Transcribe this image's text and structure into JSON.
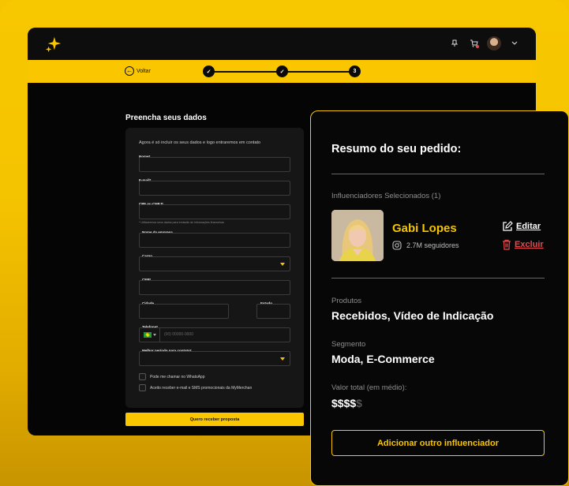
{
  "topbar": {
    "logo_icon": "sparkle-icon",
    "icons": [
      "pin-icon",
      "cart-icon",
      "user-avatar",
      "chevron-down-icon"
    ]
  },
  "progress": {
    "back_label": "Voltar",
    "steps": [
      "✓",
      "✓",
      "3"
    ]
  },
  "form": {
    "title": "Preencha seus dados",
    "intro": "Agora é só incluir os seus dados e logo entraremos em contato",
    "fields": {
      "nome": "Nome*",
      "email": "E-mail*",
      "cpf": "CPF ou CNPJ*",
      "cpf_hint": "* Utilizaremos seus dados para emissão de informações financeiras",
      "empresa": "Nome da empresa",
      "cargo": "Cargo",
      "cep": "CEP*",
      "cidade": "Cidade",
      "estado": "Estado",
      "telefone": "Telefone*",
      "telefone_placeholder": "(00) 00000-0000",
      "periodo": "Melhor período para contato*"
    },
    "checks": {
      "whatsapp": "Pode me chamar no WhatsApp",
      "promo": "Aceito receber e-mail e SMS promocionais da MyMerchan"
    },
    "submit_label": "Quero receber proposta"
  },
  "summary": {
    "title": "Resumo do seu pedido:",
    "selected_label": "Influenciadores Selecionados (1)",
    "influencer": {
      "name": "Gabi Lopes",
      "followers": "2.7M seguidores",
      "edit_label": "Editar",
      "delete_label": "Excluir"
    },
    "products_label": "Produtos",
    "products_value": "Recebidos, Vídeo de Indicação",
    "segment_label": "Segmento",
    "segment_value": "Moda, E-Commerce",
    "total_label": "Valor total (em médio):",
    "price_on": "$$$$",
    "price_off": "$",
    "add_button": "Adicionar outro influenciador"
  },
  "colors": {
    "accent": "#f9c600",
    "danger": "#e5484d",
    "background": "#050505"
  }
}
